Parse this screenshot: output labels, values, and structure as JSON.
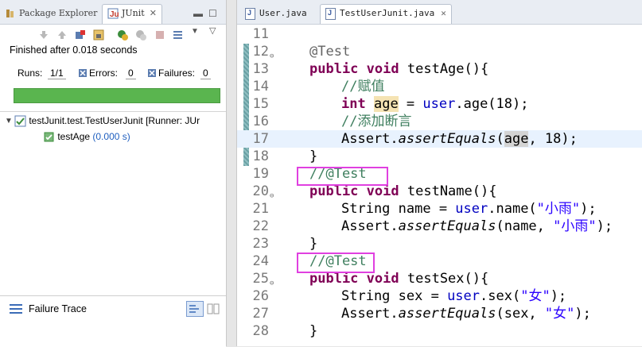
{
  "left_panel": {
    "tabs": [
      {
        "label": "Package Explorer",
        "icon": "package-explorer-icon"
      },
      {
        "label": "JUnit",
        "icon": "junit-icon",
        "active": true
      }
    ],
    "status": "Finished after 0.018 seconds",
    "counters": {
      "runs_label": "Runs:",
      "runs_value": "1/1",
      "errors_label": "Errors:",
      "errors_value": "0",
      "failures_label": "Failures:",
      "failures_value": "0"
    },
    "progress": {
      "fraction": 1.0,
      "color": "#5ab54f"
    },
    "tree": {
      "root": {
        "label": "testJunit.test.TestUserJunit [Runner: JUr"
      },
      "children": [
        {
          "label": "testAge",
          "time": "(0.000 s)"
        }
      ]
    },
    "failure_trace": {
      "title": "Failure Trace"
    }
  },
  "editor": {
    "tabs": [
      {
        "label": "User.java",
        "active": false
      },
      {
        "label": "TestUserJunit.java",
        "active": true
      }
    ],
    "line_numbers": [
      "11",
      "12",
      "13",
      "14",
      "15",
      "16",
      "17",
      "18",
      "19",
      "20",
      "21",
      "22",
      "23",
      "24",
      "25",
      "26",
      "27",
      "28"
    ],
    "code": {
      "l12_ann": "@Test",
      "l13_kw1": "public",
      "l13_kw2": "void",
      "l13_rest": "testAge(){",
      "l14_cm": "//赋值",
      "l15_kw": "int",
      "l15_var": "age",
      "l15_mid": " = ",
      "l15_fld": "user",
      "l15_rest": ".age(18);",
      "l16_cm": "//添加断言",
      "l17_a": "Assert.",
      "l17_m": "assertEquals",
      "l17_b": "(",
      "l17_var": "age",
      "l17_c": ", 18);",
      "l18": "}",
      "l19_cm": "//@Test",
      "l20_kw1": "public",
      "l20_kw2": "void",
      "l20_rest": "testName(){",
      "l21_a": "String name = ",
      "l21_fld": "user",
      "l21_b": ".name(",
      "l21_str": "\"小雨\"",
      "l21_c": ");",
      "l22_a": "Assert.",
      "l22_m": "assertEquals",
      "l22_b": "(name, ",
      "l22_str": "\"小雨\"",
      "l22_c": ");",
      "l23": "}",
      "l24_cm": "//@Test",
      "l25_kw1": "public",
      "l25_kw2": "void",
      "l25_rest": "testSex(){",
      "l26_a": "String sex = ",
      "l26_fld": "user",
      "l26_b": ".sex(",
      "l26_str": "\"女\"",
      "l26_c": ");",
      "l27_a": "Assert.",
      "l27_m": "assertEquals",
      "l27_b": "(sex, ",
      "l27_str": "\"女\"",
      "l27_c": ");",
      "l28": "}"
    },
    "highlight_box_color": "#e040e0"
  }
}
